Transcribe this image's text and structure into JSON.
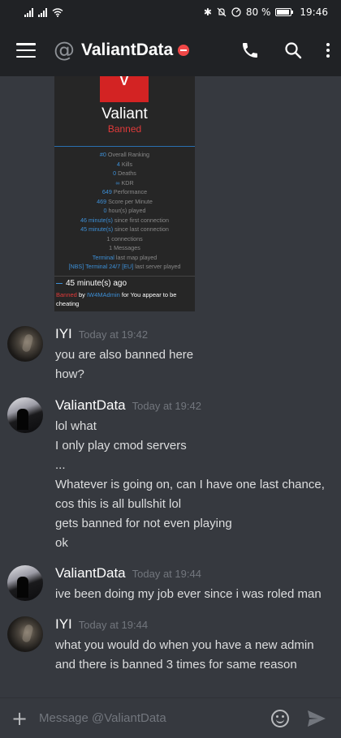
{
  "status_bar": {
    "bluetooth": "✱",
    "mute": "🔕",
    "speed": "⊘",
    "battery_percent": "80 %",
    "time": "19:46"
  },
  "header": {
    "at_symbol": "@",
    "title": "ValiantData",
    "icons": [
      "menu-icon",
      "phone-icon",
      "search-icon",
      "more-icon"
    ]
  },
  "embed": {
    "logo_letter": "V",
    "name": "Valiant",
    "status": "Banned",
    "stats": [
      {
        "value": "#0",
        "label": " Overall Ranking"
      },
      {
        "value": "4",
        "label": " Kills"
      },
      {
        "value": "0",
        "label": " Deaths"
      },
      {
        "value": "∞",
        "label": " KDR"
      },
      {
        "value": "649",
        "label": " Performance"
      },
      {
        "value": "469",
        "label": " Score per Minute"
      },
      {
        "value": "0",
        "label": " hour(s) played"
      },
      {
        "value": "46 minute(s)",
        "label": " since first connection"
      },
      {
        "value": "45 minute(s)",
        "label": " since last connection"
      },
      {
        "value": "",
        "label": "1 connections"
      },
      {
        "value": "",
        "label": "1 Messages"
      },
      {
        "value": "Terminal",
        "label": " last map played"
      },
      {
        "value": "[NBS] Terminal 24/7 [EU]",
        "label": " last server played"
      }
    ],
    "ago": "45 minute(s) ago",
    "reason_prefix": "Banned",
    "reason_by": " by ",
    "reason_admin": "IW4MAdmin",
    "reason_for": " for ",
    "reason_text": "You appear to be cheating"
  },
  "messages": [
    {
      "author": "IYI",
      "time": "Today at 19:42",
      "lines": [
        "you are also banned here",
        "how?"
      ]
    },
    {
      "author": "ValiantData",
      "time": "Today at 19:42",
      "lines": [
        "lol what",
        "I only play cmod servers",
        "...",
        "Whatever is going on, can I have one last chance,",
        "cos this is all bullshit lol",
        "gets banned for not even playing",
        "ok"
      ]
    },
    {
      "author": "ValiantData",
      "time": "Today at 19:44",
      "lines": [
        "ive been doing my job ever since i was roled man"
      ]
    },
    {
      "author": "IYI",
      "time": "Today at 19:44",
      "lines": [
        "what you would do when you have a new admin",
        "and there is banned 3 times for same reason"
      ]
    }
  ],
  "composer": {
    "placeholder": "Message @ValiantData",
    "plus": "+"
  }
}
